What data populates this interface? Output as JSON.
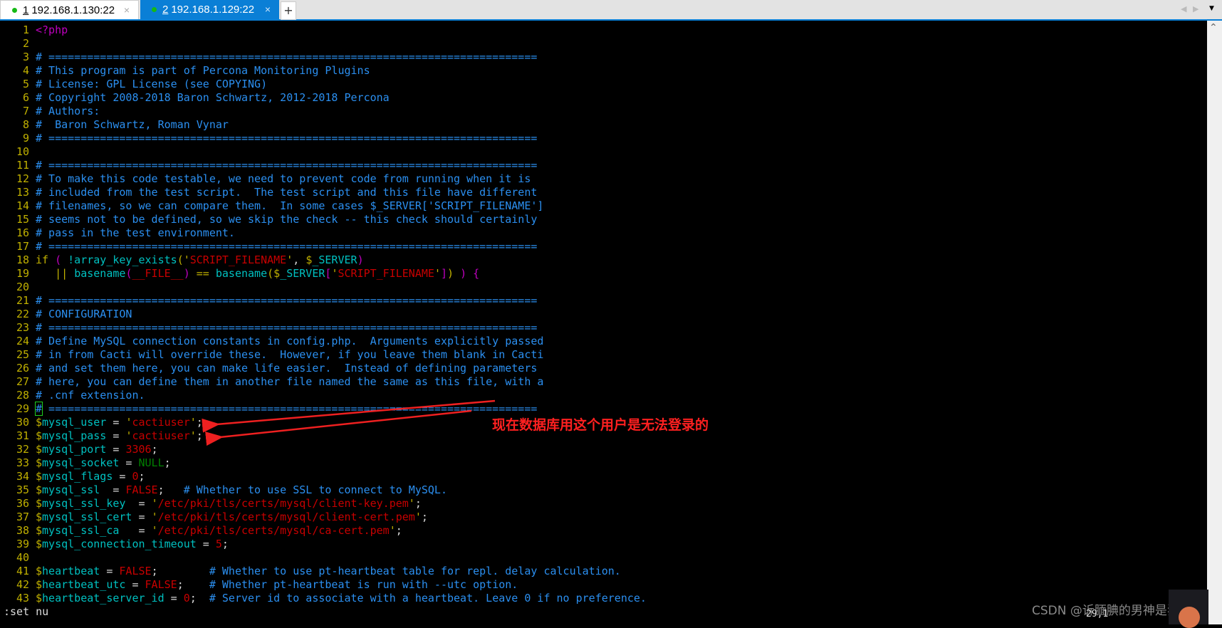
{
  "tabs": [
    {
      "number": "1",
      "label": "192.168.1.130:22",
      "active": false,
      "status_color": "#16b916"
    },
    {
      "number": "2",
      "label": "192.168.1.129:22",
      "active": true,
      "status_color": "#16b916"
    }
  ],
  "tabbar": {
    "add": "+",
    "close": "×",
    "prev": "◀",
    "next": "▶",
    "menu": "▼"
  },
  "code": [
    [
      [
        "p",
        "<?php"
      ]
    ],
    [],
    [
      [
        "c",
        "# ============================================================================"
      ]
    ],
    [
      [
        "c",
        "# This program is part of Percona Monitoring Plugins"
      ]
    ],
    [
      [
        "c",
        "# License: GPL License (see COPYING)"
      ]
    ],
    [
      [
        "c",
        "# Copyright 2008-2018 Baron Schwartz, 2012-2018 Percona"
      ]
    ],
    [
      [
        "c",
        "# Authors:"
      ]
    ],
    [
      [
        "c",
        "#  Baron Schwartz, Roman Vynar"
      ]
    ],
    [
      [
        "c",
        "# ============================================================================"
      ]
    ],
    [],
    [
      [
        "c",
        "# ============================================================================"
      ]
    ],
    [
      [
        "c",
        "# To make this code testable, we need to prevent code from running when it is"
      ]
    ],
    [
      [
        "c",
        "# included from the test script.  The test script and this file have different"
      ]
    ],
    [
      [
        "c",
        "# filenames, so we can compare them.  In some cases $_SERVER['SCRIPT_FILENAME']"
      ]
    ],
    [
      [
        "c",
        "# seems not to be defined, so we skip the check -- this check should certainly"
      ]
    ],
    [
      [
        "c",
        "# pass in the test environment."
      ]
    ],
    [
      [
        "c",
        "# ============================================================================"
      ]
    ],
    [
      [
        "y",
        "if"
      ],
      [
        "w",
        " "
      ],
      [
        "p",
        "("
      ],
      [
        "w",
        " "
      ],
      [
        "n",
        "!array_key_exists"
      ],
      [
        "y",
        "('"
      ],
      [
        "s",
        "SCRIPT_FILENAME"
      ],
      [
        "y",
        "'"
      ],
      [
        "w",
        ", "
      ],
      [
        "v",
        "$"
      ],
      [
        "n",
        "_SERVER"
      ],
      [
        "p",
        ")"
      ]
    ],
    [
      [
        "w",
        "   "
      ],
      [
        "y",
        "||"
      ],
      [
        "w",
        " "
      ],
      [
        "n",
        "basename"
      ],
      [
        "p",
        "("
      ],
      [
        "s",
        "__FILE__"
      ],
      [
        "p",
        ")"
      ],
      [
        "w",
        " "
      ],
      [
        "y",
        "=="
      ],
      [
        "w",
        " "
      ],
      [
        "n",
        "basename"
      ],
      [
        "y",
        "("
      ],
      [
        "v",
        "$"
      ],
      [
        "n",
        "_SERVER"
      ],
      [
        "p",
        "["
      ],
      [
        "y",
        "'"
      ],
      [
        "s",
        "SCRIPT_FILENAME"
      ],
      [
        "y",
        "'"
      ],
      [
        "p",
        "]"
      ],
      [
        "y",
        ")"
      ],
      [
        "w",
        " "
      ],
      [
        "p",
        ") {"
      ]
    ],
    [],
    [
      [
        "c",
        "# ============================================================================"
      ]
    ],
    [
      [
        "c",
        "# CONFIGURATION"
      ]
    ],
    [
      [
        "c",
        "# ============================================================================"
      ]
    ],
    [
      [
        "c",
        "# Define MySQL connection constants in config.php.  Arguments explicitly passed"
      ]
    ],
    [
      [
        "c",
        "# in from Cacti will override these.  However, if you leave them blank in Cacti"
      ]
    ],
    [
      [
        "c",
        "# and set them here, you can make life easier.  Instead of defining parameters"
      ]
    ],
    [
      [
        "c",
        "# here, you can define them in another file named the same as this file, with a"
      ]
    ],
    [
      [
        "c",
        "# .cnf extension."
      ]
    ],
    [
      [
        "cursor",
        "#"
      ],
      [
        "c",
        " ============================================================================"
      ]
    ],
    [
      [
        "v",
        "$"
      ],
      [
        "n",
        "mysql_user"
      ],
      [
        "w",
        " = "
      ],
      [
        "y",
        "'"
      ],
      [
        "s",
        "cactiuser"
      ],
      [
        "y",
        "'"
      ],
      [
        "w",
        ";"
      ]
    ],
    [
      [
        "v",
        "$"
      ],
      [
        "n",
        "mysql_pass"
      ],
      [
        "w",
        " = "
      ],
      [
        "y",
        "'"
      ],
      [
        "s",
        "cactiuser"
      ],
      [
        "y",
        "'"
      ],
      [
        "w",
        ";"
      ]
    ],
    [
      [
        "v",
        "$"
      ],
      [
        "n",
        "mysql_port"
      ],
      [
        "w",
        " = "
      ],
      [
        "s",
        "3306"
      ],
      [
        "w",
        ";"
      ]
    ],
    [
      [
        "v",
        "$"
      ],
      [
        "n",
        "mysql_socket"
      ],
      [
        "w",
        " = "
      ],
      [
        "g",
        "NULL"
      ],
      [
        "w",
        ";"
      ]
    ],
    [
      [
        "v",
        "$"
      ],
      [
        "n",
        "mysql_flags"
      ],
      [
        "w",
        " = "
      ],
      [
        "s",
        "0"
      ],
      [
        "w",
        ";"
      ]
    ],
    [
      [
        "v",
        "$"
      ],
      [
        "n",
        "mysql_ssl"
      ],
      [
        "w",
        "  = "
      ],
      [
        "s",
        "FALSE"
      ],
      [
        "w",
        ";   "
      ],
      [
        "c",
        "# Whether to use SSL to connect to MySQL."
      ]
    ],
    [
      [
        "v",
        "$"
      ],
      [
        "n",
        "mysql_ssl_key"
      ],
      [
        "w",
        "  = "
      ],
      [
        "y",
        "'"
      ],
      [
        "s",
        "/etc/pki/tls/certs/mysql/client-key.pem"
      ],
      [
        "y",
        "'"
      ],
      [
        "w",
        ";"
      ]
    ],
    [
      [
        "v",
        "$"
      ],
      [
        "n",
        "mysql_ssl_cert"
      ],
      [
        "w",
        " = "
      ],
      [
        "y",
        "'"
      ],
      [
        "s",
        "/etc/pki/tls/certs/mysql/client-cert.pem"
      ],
      [
        "y",
        "'"
      ],
      [
        "w",
        ";"
      ]
    ],
    [
      [
        "v",
        "$"
      ],
      [
        "n",
        "mysql_ssl_ca"
      ],
      [
        "w",
        "   = "
      ],
      [
        "y",
        "'"
      ],
      [
        "s",
        "/etc/pki/tls/certs/mysql/ca-cert.pem"
      ],
      [
        "y",
        "'"
      ],
      [
        "w",
        ";"
      ]
    ],
    [
      [
        "v",
        "$"
      ],
      [
        "n",
        "mysql_connection_timeout"
      ],
      [
        "w",
        " = "
      ],
      [
        "s",
        "5"
      ],
      [
        "w",
        ";"
      ]
    ],
    [],
    [
      [
        "v",
        "$"
      ],
      [
        "n",
        "heartbeat"
      ],
      [
        "w",
        " = "
      ],
      [
        "s",
        "FALSE"
      ],
      [
        "w",
        ";        "
      ],
      [
        "c",
        "# Whether to use pt-heartbeat table for repl. delay calculation."
      ]
    ],
    [
      [
        "v",
        "$"
      ],
      [
        "n",
        "heartbeat_utc"
      ],
      [
        "w",
        " = "
      ],
      [
        "s",
        "FALSE"
      ],
      [
        "w",
        ";    "
      ],
      [
        "c",
        "# Whether pt-heartbeat is run with --utc option."
      ]
    ],
    [
      [
        "v",
        "$"
      ],
      [
        "n",
        "heartbeat_server_id"
      ],
      [
        "w",
        " = "
      ],
      [
        "s",
        "0"
      ],
      [
        "w",
        ";  "
      ],
      [
        "c",
        "# Server id to associate with a heartbeat. Leave 0 if no preference."
      ]
    ]
  ],
  "command_line": ":set nu",
  "cursor_position": "29,1",
  "annotation": {
    "text": "现在数据库用这个用户是无法登录的",
    "color": "#ff2020"
  },
  "watermark": "CSDN @诉腼腆的男神是狂神",
  "scrollbar": {
    "up": "⌃"
  }
}
